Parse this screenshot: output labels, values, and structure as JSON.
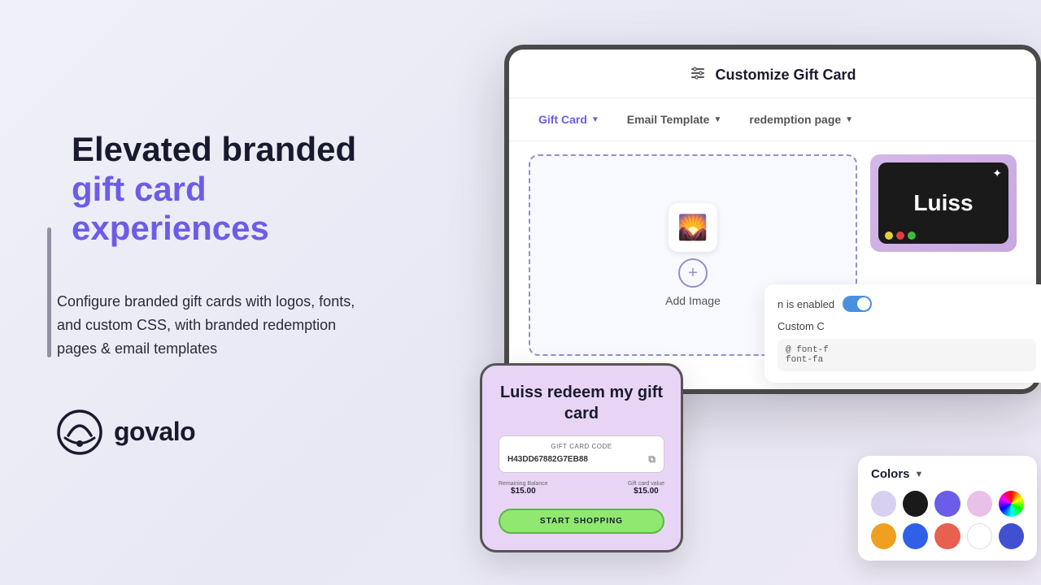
{
  "page": {
    "background": "#f0f0f8"
  },
  "left": {
    "headline_line1": "Elevated branded",
    "headline_line2": "gift card experiences",
    "description": "Configure branded gift cards with logos, fonts, and custom CSS, with branded redemption pages & email templates",
    "logo_text": "govalo"
  },
  "main_window": {
    "title": "Customize Gift Card",
    "tabs": [
      {
        "label": "Gift Card",
        "active": true
      },
      {
        "label": "Email Template",
        "active": false
      },
      {
        "label": "redemption page",
        "active": false
      }
    ],
    "add_image_label": "Add Image"
  },
  "luiss_card": {
    "name": "Luiss"
  },
  "redemption": {
    "title": "Luiss redeem my gift card",
    "code_label": "GIFT CARD CODE",
    "code_value": "H43DD67882G7EB88",
    "remaining_balance_label": "Remaining Balance",
    "remaining_balance_value": "$15.00",
    "gift_card_value_label": "Gift card value",
    "gift_card_value": "$15.00",
    "button_label": "START SHOPPING"
  },
  "css_panel": {
    "enabled_label": "n is enabled",
    "custom_label": "Custom C",
    "css_line1": "@ font-f",
    "css_line2": "font-fa"
  },
  "colors_panel": {
    "title": "Colors",
    "chevron": "▼",
    "row1": [
      {
        "color": "#d8d0f0",
        "name": "lavender"
      },
      {
        "color": "#1a1a1a",
        "name": "black"
      },
      {
        "color": "#6b5de8",
        "name": "purple"
      },
      {
        "color": "#e8c0e8",
        "name": "pink"
      },
      {
        "color": "conic-gradient(red, yellow, lime, cyan, blue, magenta, red)",
        "name": "rainbow"
      }
    ],
    "row2": [
      {
        "color": "#f0a020",
        "name": "orange"
      },
      {
        "color": "#3060e8",
        "name": "blue"
      },
      {
        "color": "#e86050",
        "name": "coral"
      },
      {
        "color": "#ffffff",
        "name": "white"
      },
      {
        "color": "#4050d0",
        "name": "dark-blue"
      }
    ]
  }
}
